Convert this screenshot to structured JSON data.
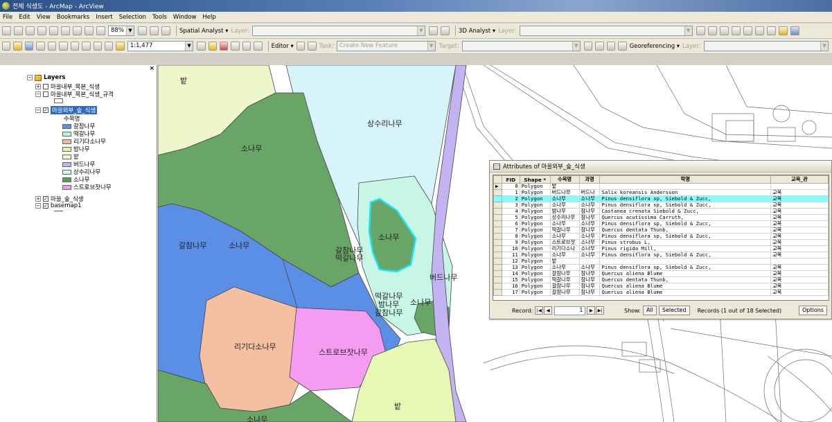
{
  "window": {
    "title": "전체 식생도 - ArcMap - ArcView"
  },
  "menu": [
    "File",
    "Edit",
    "View",
    "Bookmarks",
    "Insert",
    "Selection",
    "Tools",
    "Window",
    "Help"
  ],
  "toolbar1": {
    "scale_pct": "88%",
    "spatial_analyst": "Spatial Analyst ▾",
    "layer_label": "Layer:",
    "analyst_3d": "3D Analyst ▾",
    "layer_label2": "Layer:"
  },
  "toolbar2": {
    "scale": "1:1,477",
    "editor": "Editor ▾",
    "task_label": "Task:",
    "task_value": "Create New Feature",
    "target_label": "Target:",
    "georef": "Georeferencing ▾",
    "layer_label3": "Layer:"
  },
  "toc": {
    "root": "Layers",
    "layers": [
      {
        "name": "마을내부_목본_식생",
        "checked": false
      },
      {
        "name": "마을내부_목본_식생_규격",
        "checked": false
      },
      {
        "name": "마을외부_숲_식생",
        "checked": true
      },
      {
        "name": "마을_숲_식생",
        "checked": true
      },
      {
        "name": "basemap1",
        "checked": true
      }
    ],
    "legend_field": "수목명",
    "legend": [
      {
        "label": "갈참나무",
        "color": "#5b8fe6"
      },
      {
        "label": "떡갈나무",
        "color": "#b6f2e9"
      },
      {
        "label": "리기다소나무",
        "color": "#f2b9a0"
      },
      {
        "label": "밤나무",
        "color": "#d9f5a6"
      },
      {
        "label": "밭",
        "color": "#f4f9d2"
      },
      {
        "label": "버드나무",
        "color": "#c3b3f2"
      },
      {
        "label": "상수리나무",
        "color": "#d6f4f9"
      },
      {
        "label": "소나무",
        "color": "#5c9a5a"
      },
      {
        "label": "스트로브잣나무",
        "color": "#f59cf2"
      }
    ]
  },
  "map": {
    "colors": {
      "field": "#eef7cb",
      "oak_cork": "#5b8fe6",
      "oak_sawtooth": "#d6f4f9",
      "pine": "#6aa568",
      "daimyo": "#c7f7e4",
      "pitch_pine": "#f5c0a2",
      "white_pine": "#f59cf2",
      "willow": "#c3b3f2",
      "chestnut": "#e7f8b5"
    },
    "labels": [
      {
        "id": "field-top",
        "text": "밭"
      },
      {
        "id": "sangsuri",
        "text": "상수리나무"
      },
      {
        "id": "pine-top",
        "text": "소나무"
      },
      {
        "id": "galcham",
        "text": "갈참나무"
      },
      {
        "id": "pine-mid",
        "text": "소나무"
      },
      {
        "id": "galcham-ddeok",
        "text": "갈참나무\n떡갈나무"
      },
      {
        "id": "pine-sel",
        "text": "소나무"
      },
      {
        "id": "willow",
        "text": "버드나무"
      },
      {
        "id": "mix",
        "text": "떡갈나무\n밤나무\n갈참나무"
      },
      {
        "id": "pine-small",
        "text": "소나무"
      },
      {
        "id": "rigida",
        "text": "리기다소나무"
      },
      {
        "id": "strobus",
        "text": "스트로브잣나무"
      },
      {
        "id": "field-bottom",
        "text": "밭"
      },
      {
        "id": "pine-bottom",
        "text": "소나무"
      }
    ]
  },
  "attributes": {
    "title": "Attributes of 마을외부_숲_식생",
    "columns": [
      "FID",
      "Shape *",
      "수목명",
      "과명",
      "학명",
      "교목_관"
    ],
    "rows": [
      {
        "fid": "0",
        "shape": "Polygon",
        "name": "밭",
        "family": "",
        "sci": "",
        "type": ""
      },
      {
        "fid": "1",
        "shape": "Polygon",
        "name": "버드나무",
        "family": "버드나",
        "sci": "Salix koreansis Andersson",
        "type": "교목"
      },
      {
        "fid": "2",
        "shape": "Polygon",
        "name": "소나무",
        "family": "소나무",
        "sci": "Pinus densiflora sp, Siebold & Zucc,",
        "type": "교목"
      },
      {
        "fid": "3",
        "shape": "Polygon",
        "name": "소나무",
        "family": "소나무",
        "sci": "Pinus densiflora sp, Siebold & Zucc,",
        "type": "교목"
      },
      {
        "fid": "4",
        "shape": "Polygon",
        "name": "밤나무",
        "family": "참나무",
        "sci": "Castanea crenata Siebold & Zucc,",
        "type": "교목"
      },
      {
        "fid": "5",
        "shape": "Polygon",
        "name": "상수리나무",
        "family": "참나무",
        "sci": "Quercus acutissima Carruth,",
        "type": "교목"
      },
      {
        "fid": "6",
        "shape": "Polygon",
        "name": "소나무",
        "family": "소나무",
        "sci": "Pinus densiflora sp, Siebold & Zucc,",
        "type": "교목"
      },
      {
        "fid": "7",
        "shape": "Polygon",
        "name": "떡갈나무",
        "family": "참나무",
        "sci": "Quercus dentata Thunb,",
        "type": "교목"
      },
      {
        "fid": "8",
        "shape": "Polygon",
        "name": "소나무",
        "family": "소나무",
        "sci": "Pinus densiflora sp, Siebold & Zucc,",
        "type": "교목"
      },
      {
        "fid": "9",
        "shape": "Polygon",
        "name": "스트로브잣",
        "family": "소나무",
        "sci": "Pinus strobus L,",
        "type": "교목"
      },
      {
        "fid": "10",
        "shape": "Polygon",
        "name": "리기다소나",
        "family": "소나무",
        "sci": "Pinus rigida Mill,",
        "type": "교목"
      },
      {
        "fid": "11",
        "shape": "Polygon",
        "name": "소나무",
        "family": "소나무",
        "sci": "Pinus densiflora sp, Siebold & Zucc,",
        "type": "교목"
      },
      {
        "fid": "12",
        "shape": "Polygon",
        "name": "밭",
        "family": "",
        "sci": "",
        "type": ""
      },
      {
        "fid": "13",
        "shape": "Polygon",
        "name": "소나무",
        "family": "소나무",
        "sci": "Pinus densiflora sp, Siebold & Zucc,",
        "type": "교목"
      },
      {
        "fid": "14",
        "shape": "Polygon",
        "name": "갈참나무",
        "family": "참나무",
        "sci": "Quercus aliena Blume",
        "type": "교목"
      },
      {
        "fid": "15",
        "shape": "Polygon",
        "name": "떡갈나무",
        "family": "참나무",
        "sci": "Quercus dentata Thunb,",
        "type": "교목"
      },
      {
        "fid": "16",
        "shape": "Polygon",
        "name": "갈참나무",
        "family": "참나무",
        "sci": "Quercus aliena Blume",
        "type": "교목"
      },
      {
        "fid": "17",
        "shape": "Polygon",
        "name": "갈참나무",
        "family": "참나무",
        "sci": "Quercus aliena Blume",
        "type": "교목"
      }
    ],
    "selected_row": 2,
    "footer": {
      "records_label": "Record:",
      "current_record": "1",
      "show_label": "Show:",
      "all_btn": "All",
      "selected_btn": "Selected",
      "summary": "Records (1 out of 18 Selected)",
      "options_btn": "Options"
    }
  }
}
